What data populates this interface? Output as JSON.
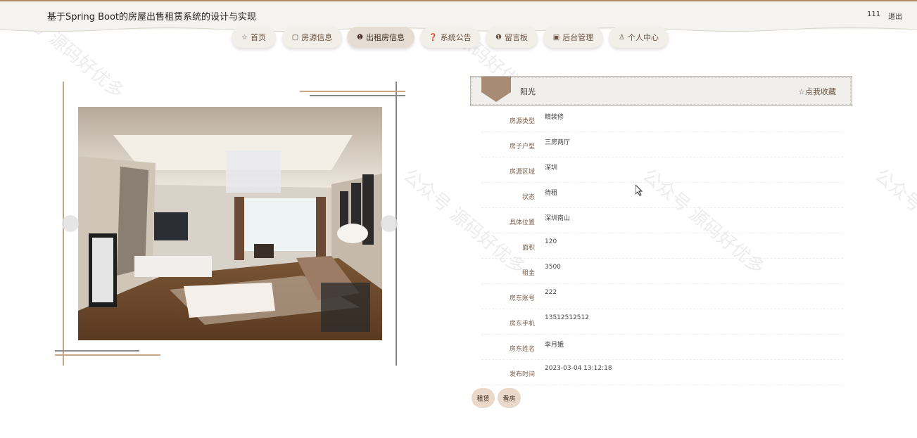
{
  "header": {
    "title": "基于Spring Boot的房屋出售租赁系统的设计与实现",
    "user": "111",
    "logout": "退出"
  },
  "nav": [
    {
      "label": "首页",
      "icon": "star-icon"
    },
    {
      "label": "房源信息",
      "icon": "bag-icon"
    },
    {
      "label": "出租房信息",
      "icon": "info-icon",
      "active": true
    },
    {
      "label": "系统公告",
      "icon": "question-icon"
    },
    {
      "label": "留言板",
      "icon": "info-icon"
    },
    {
      "label": "后台管理",
      "icon": "calendar-icon"
    },
    {
      "label": "个人中心",
      "icon": "user-icon"
    }
  ],
  "detail": {
    "name": "阳光",
    "favorite": "☆点我收藏",
    "fields": [
      {
        "label": "房源类型",
        "value": "精装修"
      },
      {
        "label": "房子户型",
        "value": "三房两厅"
      },
      {
        "label": "房源区域",
        "value": "深圳"
      },
      {
        "label": "状态",
        "value": "待租"
      },
      {
        "label": "具体位置",
        "value": "深圳南山"
      },
      {
        "label": "面积",
        "value": "120"
      },
      {
        "label": "租金",
        "value": "3500"
      },
      {
        "label": "房东账号",
        "value": "222"
      },
      {
        "label": "房东手机",
        "value": "13512512512"
      },
      {
        "label": "房东姓名",
        "value": "李月娥"
      },
      {
        "label": "发布时间",
        "value": "2023-03-04 13:12:18"
      }
    ]
  },
  "actions": {
    "rent": "租赁",
    "view": "看房"
  },
  "watermark": "公众号 源码好优多",
  "colors": {
    "accent": "#b08a67",
    "nav_bg": "#f2efe9",
    "button_bg": "#ead9ca"
  }
}
